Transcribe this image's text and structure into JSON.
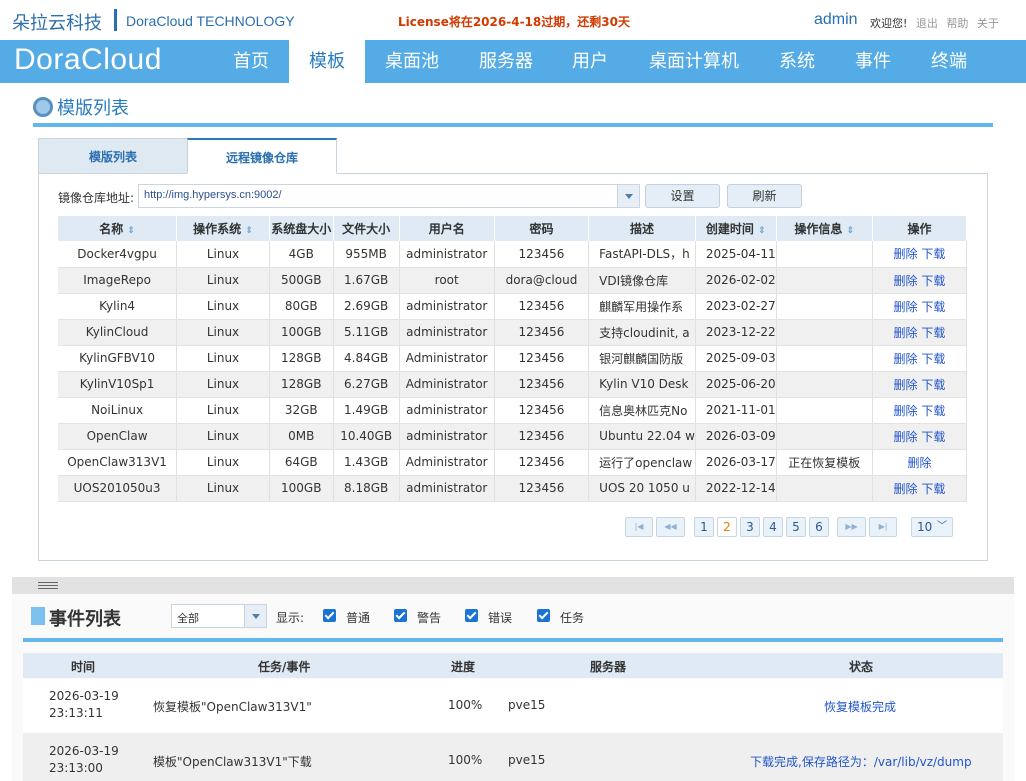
{
  "header": {
    "brand_cn": "朵拉云科技",
    "brand_en": "DoraCloud TECHNOLOGY",
    "license": "License将在2026-4-18过期，还剩30天",
    "user": "admin",
    "welcome": "欢迎您!",
    "logout": "退出",
    "help": "帮助",
    "about": "关于"
  },
  "nav": {
    "logo": "DoraCloud",
    "items": [
      {
        "label": "首页"
      },
      {
        "label": "模板"
      },
      {
        "label": "桌面池"
      },
      {
        "label": "服务器"
      },
      {
        "label": "用户"
      },
      {
        "label": "桌面计算机"
      },
      {
        "label": "系统"
      },
      {
        "label": "事件"
      },
      {
        "label": "终端"
      }
    ],
    "active": "模板"
  },
  "templates": {
    "title": "模版列表",
    "tabs": [
      {
        "label": "模版列表"
      },
      {
        "label": "远程镜像仓库"
      }
    ],
    "repo_label": "镜像仓库地址:",
    "repo_url": "http://img.hypersys.cn:9002/",
    "set_button": "设置",
    "refresh_button": "刷新",
    "columns": [
      "名称",
      "操作系统",
      "系统盘大小",
      "文件大小",
      "用户名",
      "密码",
      "描述",
      "创建时间",
      "操作信息",
      "操作"
    ],
    "rows": [
      {
        "name": "Docker4vgpu",
        "os": "Linux",
        "disk": "4GB",
        "size": "955MB",
        "user": "administrator",
        "password": "123456",
        "desc": "FastAPI-DLS，h",
        "created": "2025-04-11",
        "info": "",
        "actions": [
          "删除",
          "下载"
        ]
      },
      {
        "name": "ImageRepo",
        "os": "Linux",
        "disk": "500GB",
        "size": "1.67GB",
        "user": "root",
        "password": "dora@cloud",
        "desc": "VDI镜像仓库",
        "created": "2026-02-02",
        "info": "",
        "actions": [
          "删除",
          "下载"
        ]
      },
      {
        "name": "Kylin4",
        "os": "Linux",
        "disk": "80GB",
        "size": "2.69GB",
        "user": "administrator",
        "password": "123456",
        "desc": "麒麟军用操作系",
        "created": "2023-02-27",
        "info": "",
        "actions": [
          "删除",
          "下载"
        ]
      },
      {
        "name": "KylinCloud",
        "os": "Linux",
        "disk": "100GB",
        "size": "5.11GB",
        "user": "administrator",
        "password": "123456",
        "desc": "支持cloudinit, a",
        "created": "2023-12-22",
        "info": "",
        "actions": [
          "删除",
          "下载"
        ]
      },
      {
        "name": "KylinGFBV10",
        "os": "Linux",
        "disk": "128GB",
        "size": "4.84GB",
        "user": "Administrator",
        "password": "123456",
        "desc": "银河麒麟国防版",
        "created": "2025-09-03",
        "info": "",
        "actions": [
          "删除",
          "下载"
        ]
      },
      {
        "name": "KylinV10Sp1",
        "os": "Linux",
        "disk": "128GB",
        "size": "6.27GB",
        "user": "Administrator",
        "password": "123456",
        "desc": "Kylin V10 Desk",
        "created": "2025-06-20",
        "info": "",
        "actions": [
          "删除",
          "下载"
        ]
      },
      {
        "name": "NoiLinux",
        "os": "Linux",
        "disk": "32GB",
        "size": "1.49GB",
        "user": "administrator",
        "password": "123456",
        "desc": "信息奥林匹克No",
        "created": "2021-11-01",
        "info": "",
        "actions": [
          "删除",
          "下载"
        ]
      },
      {
        "name": "OpenClaw",
        "os": "Linux",
        "disk": "0MB",
        "size": "10.40GB",
        "user": "administrator",
        "password": "123456",
        "desc": "Ubuntu 22.04 w",
        "created": "2026-03-09",
        "info": "",
        "actions": [
          "删除",
          "下载"
        ]
      },
      {
        "name": "OpenClaw313V1",
        "os": "Linux",
        "disk": "64GB",
        "size": "1.43GB",
        "user": "Administrator",
        "password": "123456",
        "desc": "运行了openclaw",
        "created": "2026-03-17",
        "info": "正在恢复模板",
        "actions": [
          "删除"
        ]
      },
      {
        "name": "UOS201050u3",
        "os": "Linux",
        "disk": "100GB",
        "size": "8.18GB",
        "user": "administrator",
        "password": "123456",
        "desc": "UOS 20 1050 u",
        "created": "2022-12-14",
        "info": "",
        "actions": [
          "删除",
          "下载"
        ]
      }
    ],
    "pager": {
      "pages": [
        "1",
        "2",
        "3",
        "4",
        "5",
        "6"
      ],
      "current": 2,
      "page_size": "10"
    }
  },
  "events": {
    "title": "事件列表",
    "filter": "全部",
    "show_label": "显示:",
    "checkboxes": [
      {
        "label": "普通"
      },
      {
        "label": "警告"
      },
      {
        "label": "错误"
      },
      {
        "label": "任务"
      }
    ],
    "columns": [
      "时间",
      "任务/事件",
      "进度",
      "服务器",
      "状态"
    ],
    "rows": [
      {
        "date": "2026-03-19",
        "time": "23:13:11",
        "task": "恢复模板\"OpenClaw313V1\"",
        "progress": "100%",
        "server": "pve15",
        "status": "恢复模板完成"
      },
      {
        "date": "2026-03-19",
        "time": "23:13:00",
        "task": "模板\"OpenClaw313V1\"下载",
        "progress": "100%",
        "server": "pve15",
        "status": "下载完成,保存路径为：/var/lib/vz/dump"
      }
    ]
  },
  "colors": {
    "nav": "#55abe5",
    "accent": "#2a7bc0",
    "license": "#d23a00",
    "link": "#2255cc"
  }
}
